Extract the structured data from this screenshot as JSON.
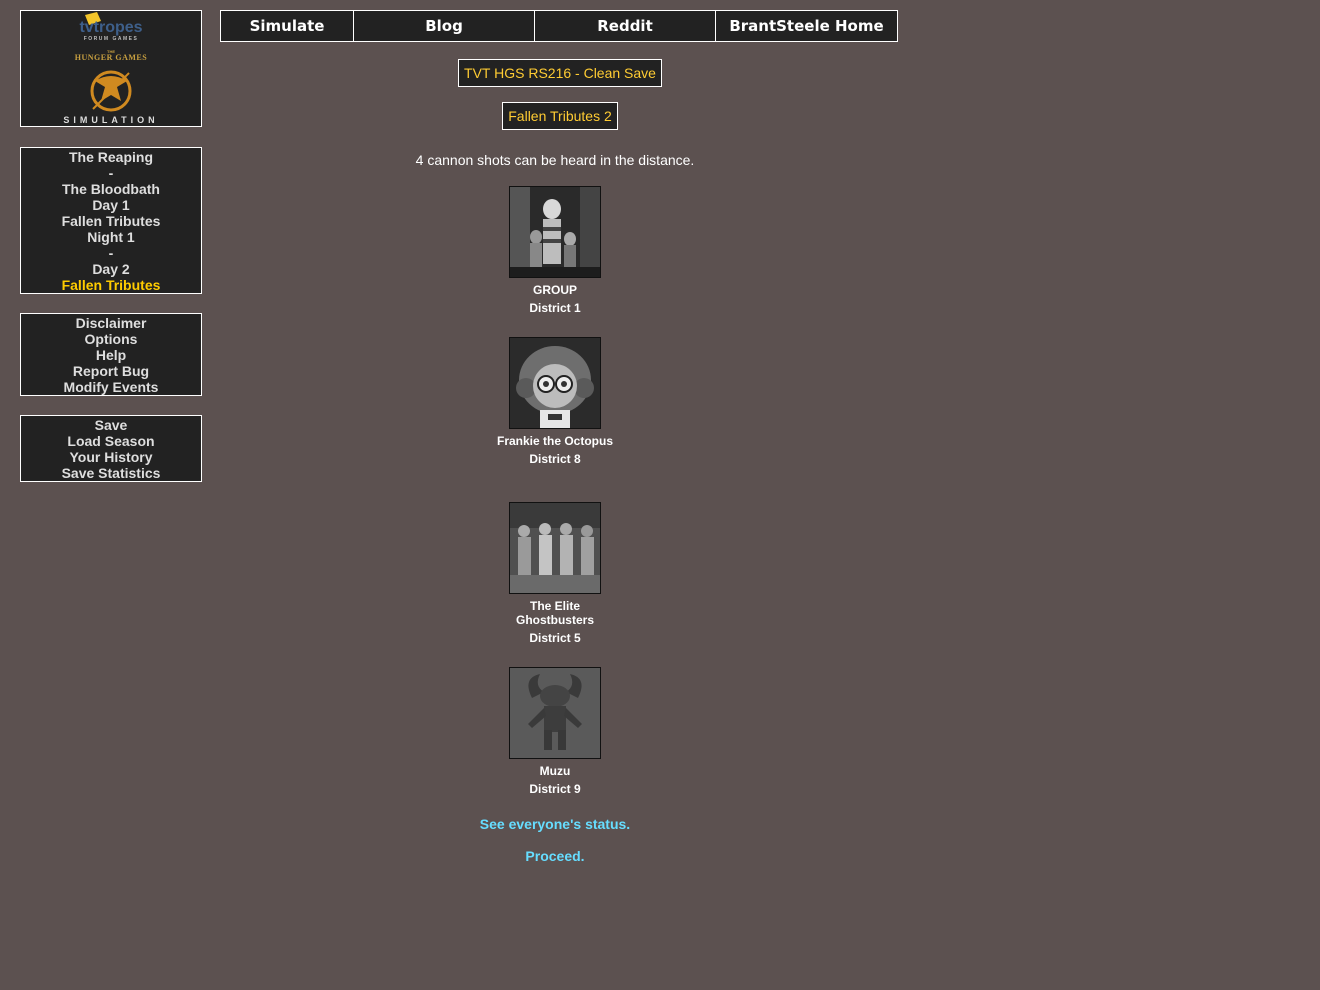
{
  "logo": {
    "brand": "tvtropes",
    "brand_sub": "FORUM GAMES",
    "the": "THE",
    "title": "HUNGER GAMES",
    "simulation": "SIMULATION"
  },
  "top_nav": [
    {
      "label": "Simulate"
    },
    {
      "label": "Blog"
    },
    {
      "label": "Reddit"
    },
    {
      "label": "BrantSteele Home"
    }
  ],
  "sidebar_nav": {
    "items": [
      {
        "label": "The Reaping"
      },
      {
        "label": "-"
      },
      {
        "label": "The Bloodbath"
      },
      {
        "label": "Day 1"
      },
      {
        "label": "Fallen Tributes"
      },
      {
        "label": "Night 1"
      },
      {
        "label": "-"
      },
      {
        "label": "Day 2"
      },
      {
        "label": "Fallen Tributes"
      }
    ]
  },
  "sidebar_menu": {
    "items": [
      {
        "label": "Disclaimer"
      },
      {
        "label": "Options"
      },
      {
        "label": "Help"
      },
      {
        "label": "Report Bug"
      },
      {
        "label": "Modify Events"
      }
    ]
  },
  "sidebar_save": {
    "items": [
      {
        "label": "Save"
      },
      {
        "label": "Load Season"
      },
      {
        "label": "Your History"
      },
      {
        "label": "Save Statistics"
      }
    ]
  },
  "main": {
    "season_title": "TVT HGS RS216 - Clean Save",
    "page_title": "Fallen Tributes 2",
    "cannon_text": "4 cannon shots can be heard in the distance.",
    "tributes": [
      {
        "name": "GROUP",
        "district": "District 1"
      },
      {
        "name": "Frankie the Octopus",
        "district": "District 8"
      },
      {
        "name": "The Elite Ghostbusters",
        "district": "District 5"
      },
      {
        "name": "Muzu",
        "district": "District 9"
      }
    ],
    "status_link": "See everyone's status.",
    "proceed_link": "Proceed."
  },
  "colors": {
    "background": "#5c5150",
    "panel": "#222222",
    "highlight": "#ffcc00",
    "link": "#66ddff"
  }
}
